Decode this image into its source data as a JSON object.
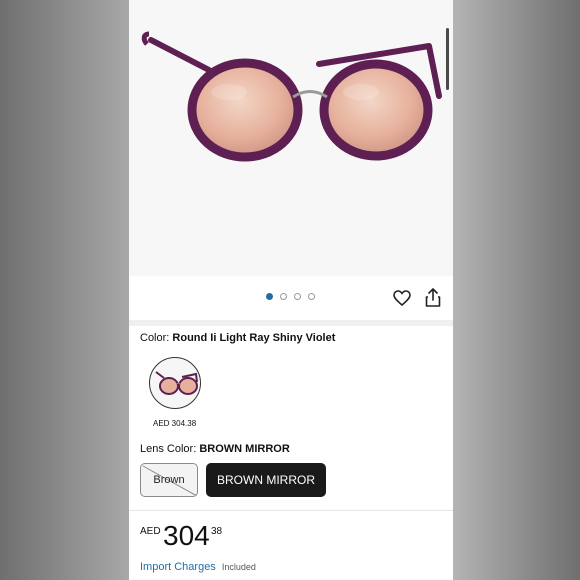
{
  "gallery": {
    "dot_count": 4,
    "active_index": 0
  },
  "icons": {
    "favorite": "heart-icon",
    "share": "share-icon",
    "carousel_indicator": "dots"
  },
  "color": {
    "label": "Color:",
    "value": "Round Ii Light Ray Shiny Violet",
    "swatch_price": "AED 304.38"
  },
  "lens": {
    "label": "Lens Color:",
    "value": "BROWN MIRROR",
    "options": [
      {
        "label": "Brown",
        "available": false
      },
      {
        "label": "BROWN MIRROR",
        "selected": true
      }
    ]
  },
  "price": {
    "currency": "AED",
    "whole": "304",
    "fraction": "38"
  },
  "import": {
    "link": "Import Charges",
    "note": "Included"
  },
  "colors": {
    "frame": "#5e1f52",
    "lens": "#e7b3a0",
    "accent_link": "#1f6fa8",
    "selected_button": "#1a1a1a",
    "active_dot": "#1f6f9f"
  }
}
